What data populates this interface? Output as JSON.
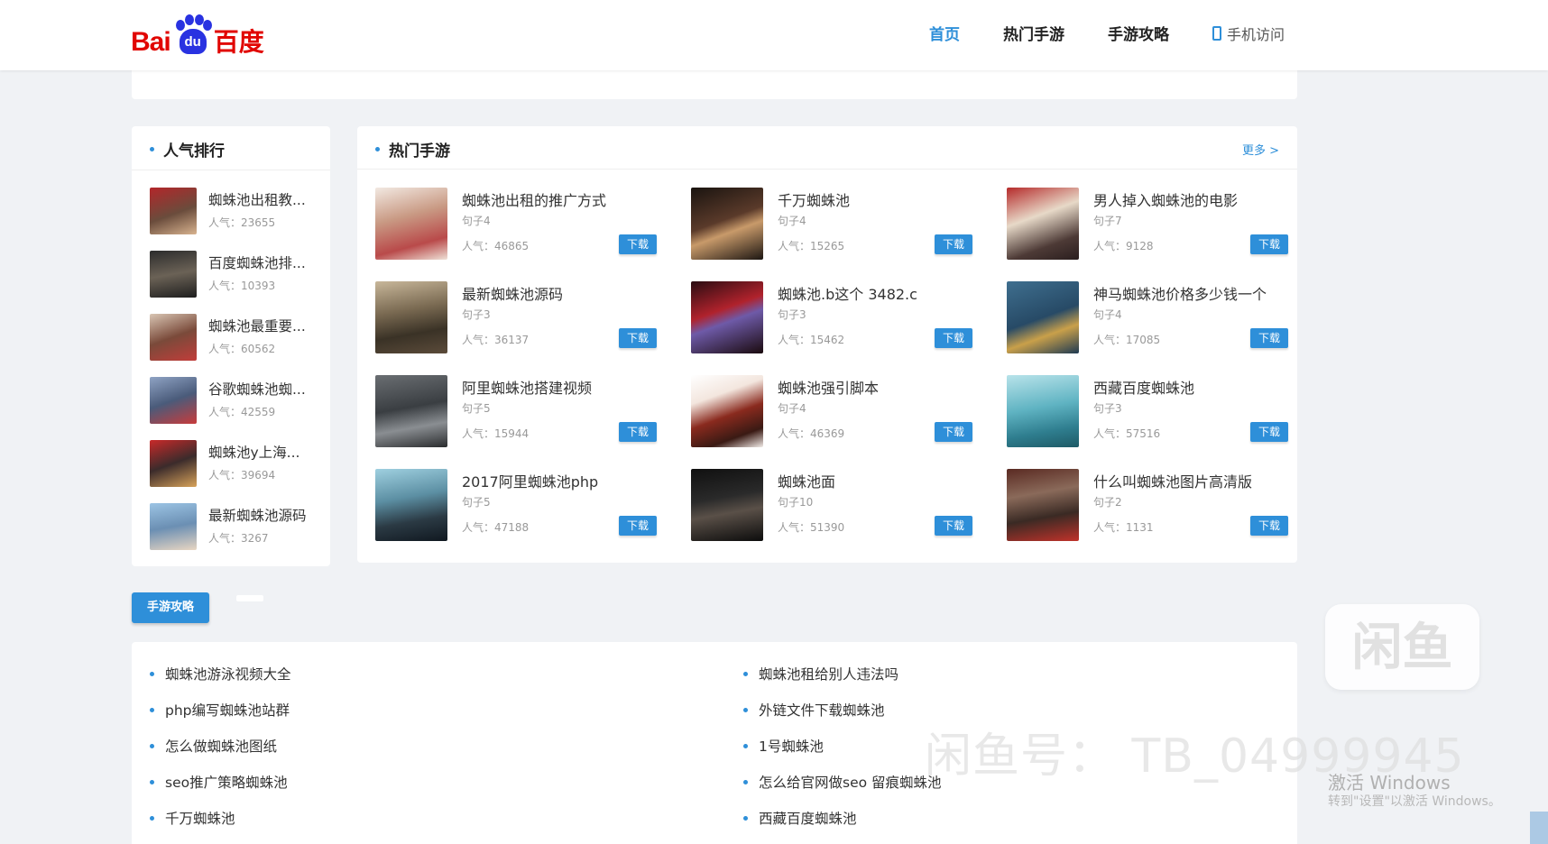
{
  "header": {
    "logo": {
      "bai": "Bai",
      "du": "du",
      "hanzi": "百度"
    },
    "nav": [
      {
        "label": "首页",
        "active": true
      },
      {
        "label": "热门手游",
        "active": false
      },
      {
        "label": "手游攻略",
        "active": false
      }
    ],
    "mobile_label": "手机访问"
  },
  "ranking": {
    "title": "人气排行",
    "items": [
      {
        "title": "蜘蛛池出租教...",
        "popularity": "人气：23655"
      },
      {
        "title": "百度蜘蛛池排...",
        "popularity": "人气：10393"
      },
      {
        "title": "蜘蛛池最重要...",
        "popularity": "人气：60562"
      },
      {
        "title": "谷歌蜘蛛池蜘...",
        "popularity": "人气：42559"
      },
      {
        "title": "蜘蛛池y上海...",
        "popularity": "人气：39694"
      },
      {
        "title": "最新蜘蛛池源码",
        "popularity": "人气：3267"
      }
    ]
  },
  "hot_games": {
    "title": "热门手游",
    "more_label": "更多 >",
    "download_label": "下载",
    "games": [
      {
        "title": "蜘蛛池出租的推广方式",
        "subtitle": "句子4",
        "popularity": "人气：46865"
      },
      {
        "title": "千万蜘蛛池",
        "subtitle": "句子4",
        "popularity": "人气：15265"
      },
      {
        "title": "男人掉入蜘蛛池的电影",
        "subtitle": "句子7",
        "popularity": "人气：9128"
      },
      {
        "title": "最新蜘蛛池源码",
        "subtitle": "句子3",
        "popularity": "人气：36137"
      },
      {
        "title": "蜘蛛池.b这个 3482.c",
        "subtitle": "句子3",
        "popularity": "人气：15462"
      },
      {
        "title": "神马蜘蛛池价格多少钱一个",
        "subtitle": "句子4",
        "popularity": "人气：17085"
      },
      {
        "title": "阿里蜘蛛池搭建视频",
        "subtitle": "句子5",
        "popularity": "人气：15944"
      },
      {
        "title": "蜘蛛池强引脚本",
        "subtitle": "句子4",
        "popularity": "人气：46369"
      },
      {
        "title": "西藏百度蜘蛛池",
        "subtitle": "句子3",
        "popularity": "人气：57516"
      },
      {
        "title": "2017阿里蜘蛛池php",
        "subtitle": "句子5",
        "popularity": "人气：47188"
      },
      {
        "title": "蜘蛛池面",
        "subtitle": "句子10",
        "popularity": "人气：51390"
      },
      {
        "title": "什么叫蜘蛛池图片高清版",
        "subtitle": "句子2",
        "popularity": "人气：1131"
      }
    ]
  },
  "guide": {
    "button_label": "手游攻略",
    "left_items": [
      "蜘蛛池游泳视频大全",
      "php编写蜘蛛池站群",
      "怎么做蜘蛛池图纸",
      "seo推广策略蜘蛛池",
      "千万蜘蛛池"
    ],
    "right_items": [
      "蜘蛛池租给别人违法吗",
      "外链文件下载蜘蛛池",
      "1号蜘蛛池",
      "怎么给官网做seo 留痕蜘蛛池",
      "西藏百度蜘蛛池"
    ]
  },
  "watermark": {
    "logo_text": "闲鱼",
    "id_text": "闲鱼号： TB_04999945",
    "activate_title": "激活 Windows",
    "activate_hint": "转到\"设置\"以激活 Windows。"
  },
  "colors": {
    "accent": "#2e8fd9",
    "baidu_red": "#e10602",
    "baidu_blue": "#2932e1"
  }
}
